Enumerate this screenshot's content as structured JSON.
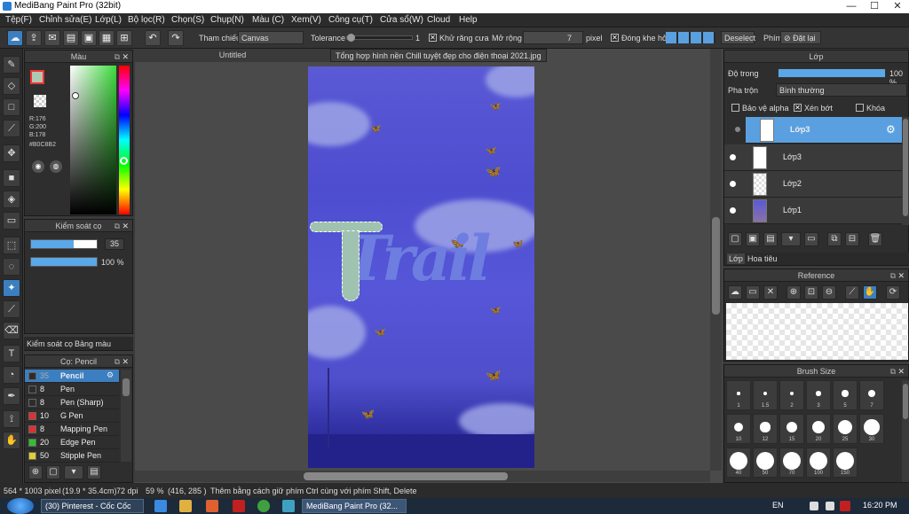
{
  "window": {
    "title": "MediBang Paint Pro (32bit)",
    "min": "—",
    "max": "☐",
    "close": "✕"
  },
  "menu": [
    "Tệp(F)",
    "Chỉnh sửa(E)",
    "Lớp(L)",
    "Bộ lọc(R)",
    "Chọn(S)",
    "Chụp(N)",
    "Màu (C)",
    "Xem(V)",
    "Công cụ(T)",
    "Cửa sổ(W)",
    "Cloud",
    "Help"
  ],
  "toolbar": {
    "ref_label": "Tham chiếu",
    "ref_value": "Canvas",
    "tol_label": "Tolerance",
    "tol_value": "1",
    "antialias_label": "Khử răng cưa",
    "expand_label": "Mở rộng",
    "expand_value": "7",
    "expand_unit": "pixel",
    "close_gap_label": "Đóng khe hở",
    "deselect": "Deselect",
    "shortcut_label": "Phím",
    "reset": "Đặt lại"
  },
  "color_panel": {
    "title": "Màu",
    "r": "R:176",
    "g": "G:200",
    "b": "B:178",
    "hex": "#B0C8B2",
    "fg_color": "#B0C8B2"
  },
  "brush_control": {
    "title": "Kiểm soát cọ",
    "size": "35",
    "opacity": "100 %",
    "size_fill": 0.65,
    "opacity_fill": 1.0
  },
  "tabs_left": {
    "brush_control": "Kiểm soát cọ",
    "palette": "Bảng màu"
  },
  "brush_list": {
    "title": "Cọ: Pencil",
    "items": [
      {
        "size": "35",
        "name": "Pencil",
        "color": "#2d2d2d",
        "selected": true
      },
      {
        "size": "8",
        "name": "Pen",
        "color": "#2d2d2d"
      },
      {
        "size": "8",
        "name": "Pen (Sharp)",
        "color": "#2d2d2d"
      },
      {
        "size": "10",
        "name": "G Pen",
        "color": "#e03030"
      },
      {
        "size": "8",
        "name": "Mapping Pen",
        "color": "#e03030"
      },
      {
        "size": "20",
        "name": "Edge Pen",
        "color": "#30c030"
      },
      {
        "size": "50",
        "name": "Stipple Pen",
        "color": "#e0d030"
      }
    ]
  },
  "document": {
    "tab": "Untitled",
    "tooltip": "Tổng hợp hình nền Chill tuyệt đẹp cho điện thoại 2021.jpg",
    "art_text": "Trail"
  },
  "layer_panel": {
    "title": "Lớp",
    "opacity_label": "Độ trong",
    "opacity_value": "100 %",
    "blend_label": "Pha trộn",
    "blend_value": "Bình thường",
    "protect_alpha": "Bảo vệ alpha",
    "clip": "Xén bớt",
    "lock": "Khóa",
    "layers": [
      "Lớp3",
      "Lớp3",
      "Lớp2",
      "Lớp1"
    ],
    "tab_layer": "Lớp",
    "tab_title": "Hoa tiêu"
  },
  "reference": {
    "title": "Reference"
  },
  "brush_size": {
    "title": "Brush Size",
    "sizes": [
      "1",
      "1.5",
      "2",
      "3",
      "5",
      "7",
      "10",
      "12",
      "15",
      "20",
      "25",
      "30",
      "40",
      "50",
      "70",
      "100",
      "150"
    ]
  },
  "status": {
    "size": "564 * 1003 pixel",
    "cm": "(19.9 * 35.4cm)",
    "dpi": "72 dpi",
    "zoom": "59 %",
    "coords": "(416, 285 )",
    "hint": "Thêm bằng cách giữ phím Ctrl cùng với phím Shift, Delete"
  },
  "taskbar": {
    "pinterest": "(30) Pinterest - Cốc Cốc",
    "medibang": "MediBang Paint Pro (32...",
    "lang": "EN",
    "time": "16:20 PM"
  }
}
